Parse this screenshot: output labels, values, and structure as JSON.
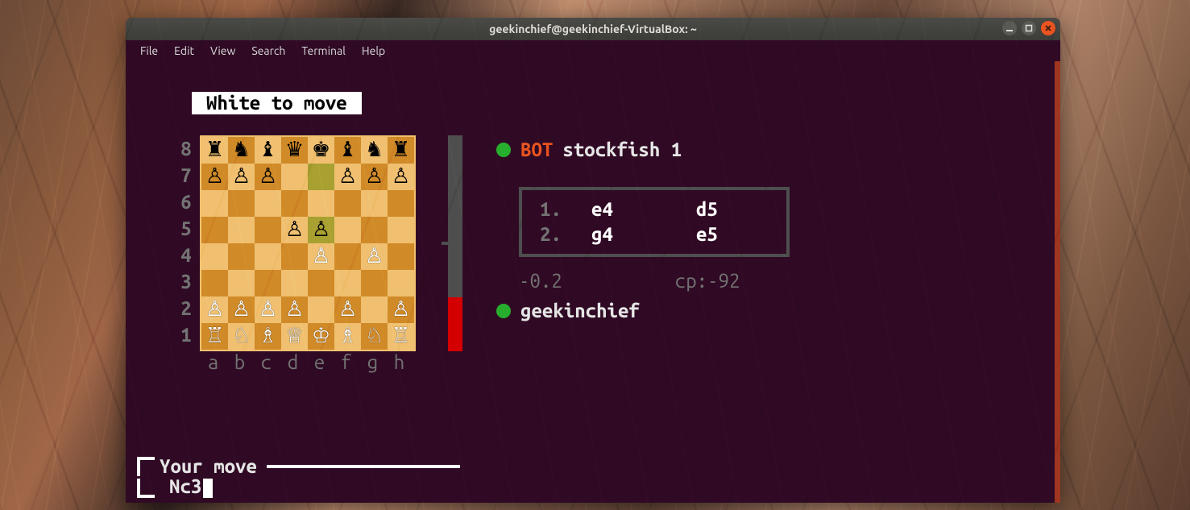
{
  "window": {
    "title": "geekinchief@geekinchief-VirtualBox: ~"
  },
  "menubar": [
    "File",
    "Edit",
    "View",
    "Search",
    "Terminal",
    "Help"
  ],
  "turn_banner": "White to move",
  "board": {
    "ranks": [
      "8",
      "7",
      "6",
      "5",
      "4",
      "3",
      "2",
      "1"
    ],
    "files": [
      "a",
      "b",
      "c",
      "d",
      "e",
      "f",
      "g",
      "h"
    ],
    "highlights": [
      "e7",
      "e5"
    ],
    "pieces": {
      "a8": "br",
      "b8": "bn",
      "c8": "bb",
      "d8": "bq",
      "e8": "bk",
      "f8": "bb",
      "g8": "bn",
      "h8": "br",
      "a7": "bp",
      "b7": "bp",
      "c7": "bp",
      "f7": "bp",
      "g7": "bp",
      "h7": "bp",
      "d5": "bp",
      "e5": "bp",
      "e4": "wp",
      "g4": "wp",
      "a2": "wp",
      "b2": "wp",
      "c2": "wp",
      "d2": "wp",
      "f2": "wp",
      "h2": "wp",
      "a1": "wr",
      "b1": "wn",
      "c1": "wb",
      "d1": "wq",
      "e1": "wk",
      "f1": "wb",
      "g1": "wn",
      "h1": "wr"
    }
  },
  "eval": {
    "percent_white": 25
  },
  "players": {
    "top": {
      "tag": "BOT",
      "name": "stockfish 1"
    },
    "bottom": {
      "name": "geekinchief"
    }
  },
  "moves": [
    {
      "n": "1.",
      "w": "e4",
      "b": "d5"
    },
    {
      "n": "2.",
      "w": "g4",
      "b": "e5"
    }
  ],
  "score_left": "-0.2",
  "score_right": "cp:-92",
  "prompt": {
    "label": "Your move",
    "value": "Nc3"
  },
  "glyphs": {
    "wk": "♔",
    "wq": "♕",
    "wr": "♖",
    "wb": "♗",
    "wn": "♘",
    "wp": "♙",
    "bk": "♚",
    "bq": "♛",
    "br": "♜",
    "bb": "♝",
    "bn": "♞",
    "bp": "♙"
  }
}
